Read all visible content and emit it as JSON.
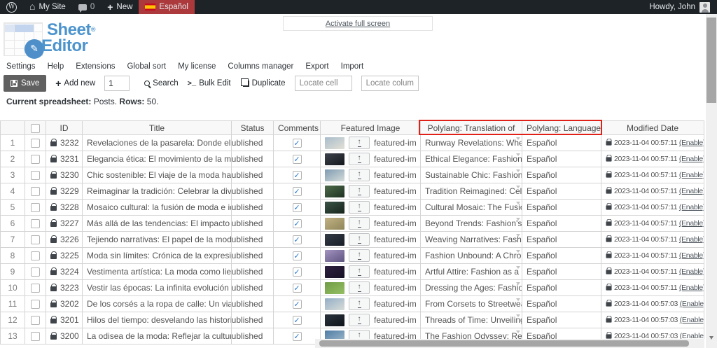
{
  "admin_bar": {
    "my_site_label": "My Site",
    "comments_count": "0",
    "new_label": "New",
    "language_label": "Español",
    "howdy_label": "Howdy, John",
    "colors": {
      "bar_bg": "#1d2327",
      "language_bg": "#ac3a3c"
    }
  },
  "header": {
    "fullscreen_link": "Activate full screen",
    "logo_line1": "Sheet",
    "logo_reg": "®",
    "logo_line2": "Editor",
    "logo_color": "#4d94cd"
  },
  "menu": {
    "items": [
      "Settings",
      "Help",
      "Extensions",
      "Global sort",
      "My license",
      "Columns manager",
      "Export",
      "Import"
    ]
  },
  "toolbar": {
    "save_label": "Save",
    "add_new_label": "Add new",
    "add_new_value": "1",
    "search_label": "Search",
    "bulk_edit_label": "Bulk Edit",
    "duplicate_label": "Duplicate",
    "locate_cell_placeholder": "Locate cell",
    "locate_column_placeholder": "Locate column"
  },
  "status_line": {
    "label_spreadsheet": "Current spreadsheet:",
    "value_spreadsheet": "Posts.",
    "label_rows": "Rows:",
    "value_rows": "50."
  },
  "grid": {
    "headers": {
      "id": "ID",
      "title": "Title",
      "status": "Status",
      "comments": "Comments",
      "featured": "Featured Image",
      "translation": "Polylang: Translation of",
      "language": "Polylang: Language",
      "modified": "Modified Date"
    },
    "highlight_color": "#e0211a",
    "rows": [
      {
        "n": "1",
        "id": "3232",
        "title": "Revelaciones de la pasarela: Donde el arte y l...",
        "status": "published",
        "featured": "featured-imag...",
        "translation": "Runway Revelations: Where Ar...",
        "language": "Español",
        "modified": "2023-11-04 00:57:11",
        "enable": "(Enable)",
        "thumb1": "#a8bccb",
        "thumb2": "#e3e0d6"
      },
      {
        "n": "2",
        "id": "3231",
        "title": "Elegancia ética: El movimiento de la moda ha...",
        "status": "published",
        "featured": "featured-imag...",
        "translation": "Ethical Elegance: Fashion's Mo...",
        "language": "Español",
        "modified": "2023-11-04 00:57:11",
        "enable": "(Enable)",
        "thumb1": "#3d434c",
        "thumb2": "#14171c"
      },
      {
        "n": "3",
        "id": "3230",
        "title": "Chic sostenible: El viaje de la moda hacia la c...",
        "status": "published",
        "featured": "featured-imag...",
        "translation": "Sustainable Chic: Fashion's Jou...",
        "language": "Español",
        "modified": "2023-11-04 00:57:11",
        "enable": "(Enable)",
        "thumb1": "#7e9bb1",
        "thumb2": "#d5dcd9"
      },
      {
        "n": "4",
        "id": "3229",
        "title": "Reimaginar la tradición: Celebrar la diversidad...",
        "status": "published",
        "featured": "featured-imag...",
        "translation": "Tradition Reimagined: Celebra...",
        "language": "Español",
        "modified": "2023-11-04 00:57:11",
        "enable": "(Enable)",
        "thumb1": "#4f6b4a",
        "thumb2": "#1d3322"
      },
      {
        "n": "5",
        "id": "3228",
        "title": "Mosaico cultural: la fusión de moda e identidad",
        "status": "published",
        "featured": "featured-imag...",
        "translation": "Cultural Mosaic: The Fusion of...",
        "language": "Español",
        "modified": "2023-11-04 00:57:11",
        "enable": "(Enable)",
        "thumb1": "#3a5547",
        "thumb2": "#18241c"
      },
      {
        "n": "6",
        "id": "3227",
        "title": "Más allá de las tendencias: El impacto de la m...",
        "status": "published",
        "featured": "featured-imag...",
        "translation": "Beyond Trends: Fashion's Impa...",
        "language": "Español",
        "modified": "2023-11-04 00:57:11",
        "enable": "(Enable)",
        "thumb1": "#c3b285",
        "thumb2": "#8e8659"
      },
      {
        "n": "7",
        "id": "3226",
        "title": "Tejiendo narrativas: El papel de la moda en la ...",
        "status": "published",
        "featured": "featured-imag...",
        "translation": "Weaving Narratives: Fashion's ...",
        "language": "Español",
        "modified": "2023-11-04 00:57:11",
        "enable": "(Enable)",
        "thumb1": "#343c46",
        "thumb2": "#181e26"
      },
      {
        "n": "8",
        "id": "3225",
        "title": "Moda sin límites: Crónica de la expresión cult...",
        "status": "published",
        "featured": "featured-imag...",
        "translation": "Fashion Unbound: A Chronicle...",
        "language": "Español",
        "modified": "2023-11-04 00:57:11",
        "enable": "(Enable)",
        "thumb1": "#a393c0",
        "thumb2": "#5f5480"
      },
      {
        "n": "9",
        "id": "3224",
        "title": "Vestimenta artística: La moda como lienzo de ...",
        "status": "published",
        "featured": "featured-imag...",
        "translation": "Artful Attire: Fashion as a Canv...",
        "language": "Español",
        "modified": "2023-11-04 00:57:11",
        "enable": "(Enable)",
        "thumb1": "#2e2140",
        "thumb2": "#171024"
      },
      {
        "n": "10",
        "id": "3223",
        "title": "Vestir las épocas: La infinita evolución de la m...",
        "status": "published",
        "featured": "featured-imag...",
        "translation": "Dressing the Ages: Fashion's E...",
        "language": "Español",
        "modified": "2023-11-04 00:57:11",
        "enable": "(Enable)",
        "thumb1": "#6f9c44",
        "thumb2": "#96bf63"
      },
      {
        "n": "11",
        "id": "3202",
        "title": "De los corsés a la ropa de calle: Un viaje por l...",
        "status": "published",
        "featured": "featured-imag...",
        "translation": "From Corsets to Streetwear: A ...",
        "language": "Español",
        "modified": "2023-11-04 00:57:03",
        "enable": "(Enable)",
        "thumb1": "#93aec6",
        "thumb2": "#d8dcd8"
      },
      {
        "n": "12",
        "id": "3201",
        "title": "Hilos del tiempo: desvelando las historias de l...",
        "status": "published",
        "featured": "featured-imag...",
        "translation": "Threads of Time: Unveiling the...",
        "language": "Español",
        "modified": "2023-11-04 00:57:03",
        "enable": "(Enable)",
        "thumb1": "#2a333d",
        "thumb2": "#10151b"
      },
      {
        "n": "13",
        "id": "3200",
        "title": "La odisea de la moda: Reflejar la cultura a trav...",
        "status": "published",
        "featured": "featured-imag...",
        "translation": "The Fashion Odyssey: Reflectin...",
        "language": "Español",
        "modified": "2023-11-04 00:57:03",
        "enable": "(Enable)",
        "thumb1": "#4f7ca6",
        "thumb2": "#9fb9c8"
      }
    ]
  }
}
